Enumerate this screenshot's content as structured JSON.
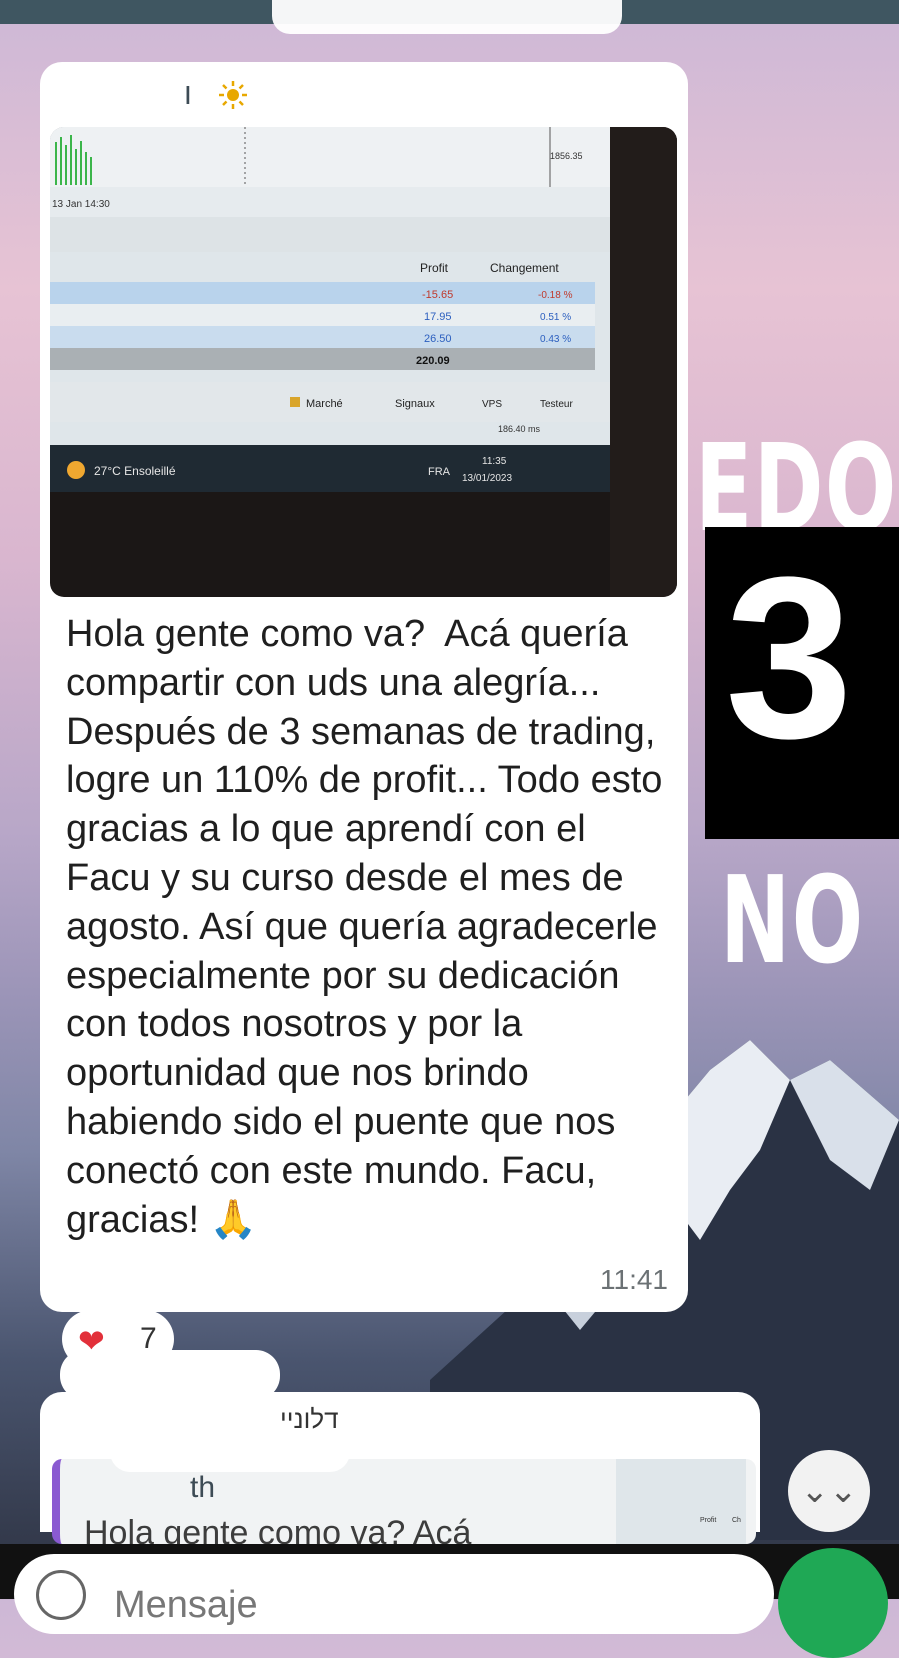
{
  "message": {
    "sender_name": "ו",
    "sender_icon": "sun-icon",
    "text": "Hola gente como va?  Acá quería compartir con uds una alegría... Después de 3 semanas de trading, logre un 110% de profit... Todo esto gracias a lo que aprendí con el Facu y su curso desde el mes de agosto. Así que quería agradecerle especialmente por su dedicación con todos nosotros y por la oportunidad que nos brindo habiendo sido el puente que nos conectó con este mundo. Facu, gracias! 🙏",
    "time": "11:41",
    "reaction": {
      "emoji": "❤",
      "count": "7"
    }
  },
  "photo": {
    "chart_timestamp": "13 Jan 14:30",
    "chart_price": "1856.35",
    "table": {
      "headers": [
        "Profit",
        "Changement"
      ],
      "rows": [
        [
          "-15.65",
          "-0.18 %"
        ],
        [
          "17.95",
          "0.51 %"
        ],
        [
          "26.50",
          "0.43 %"
        ]
      ],
      "total": "220.09"
    },
    "tabs": [
      "Marché",
      "Signaux",
      "VPS",
      "Testeur"
    ],
    "ping": "186.40 ms",
    "taskbar": {
      "weather": "27°C  Ensoleillé",
      "lang": "FRA",
      "clock_time": "11:35",
      "clock_date": "13/01/2023"
    }
  },
  "background": {
    "story_words": [
      "EDO",
      "NO",
      "O"
    ],
    "number": "3"
  },
  "quoted": {
    "header_partial": "דלוניי",
    "name": "th",
    "text": "Hola gente como va?  Acá",
    "thumb_headers": [
      "Profit",
      "Ch"
    ]
  },
  "composer": {
    "placeholder": "Mensaje"
  },
  "scroll_button": "⌄⌄"
}
